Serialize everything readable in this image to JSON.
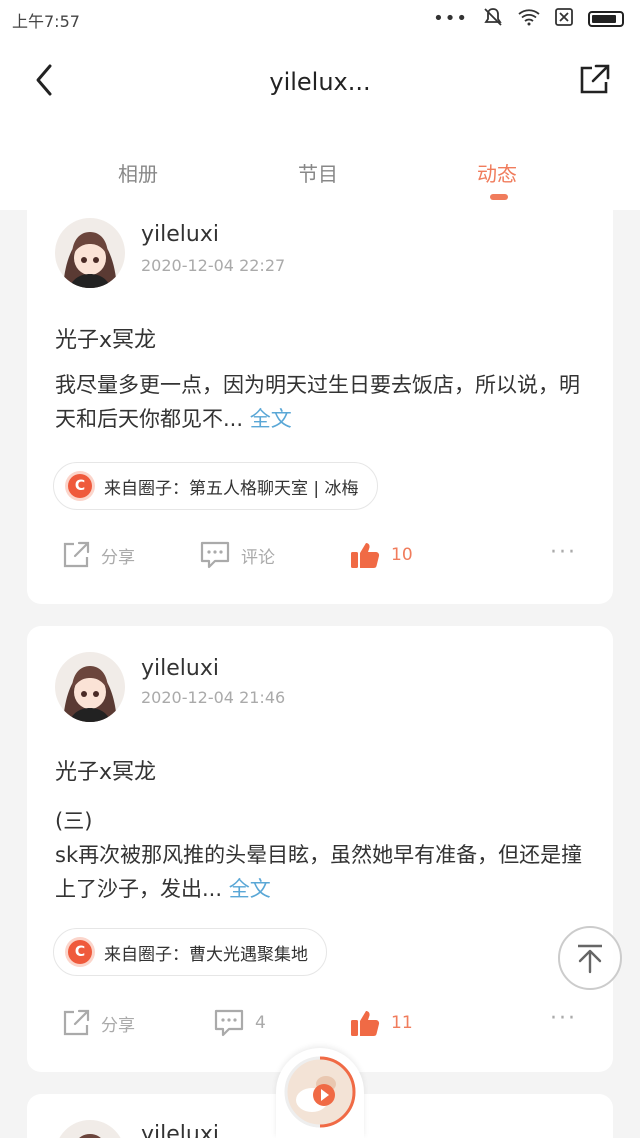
{
  "status_bar": {
    "time": "上午7:57",
    "dots": "•••"
  },
  "nav": {
    "title": "yilelux..."
  },
  "tabs": [
    {
      "label": "相册"
    },
    {
      "label": "节目"
    },
    {
      "label": "动态",
      "active": true
    }
  ],
  "posts": [
    {
      "username": "yileluxi",
      "timestamp": "2020-12-04 22:27",
      "title": "光子x冥龙",
      "body": "我尽量多更一点，因为明天过生日要去饭店，所以说，明天和后天你都见不...",
      "fulltext": "全文",
      "circle": "来自圈子：第五人格聊天室 | 冰梅",
      "share_label": "分享",
      "comment_label": "评论",
      "like_count": "10"
    },
    {
      "username": "yileluxi",
      "timestamp": "2020-12-04 21:46",
      "title": "光子x冥龙",
      "body_line1": "(三)",
      "body": "sk再次被那风推的头晕目眩，虽然她早有准备，但还是撞上了沙子，发出...",
      "fulltext": "全文",
      "circle": "来自圈子：曹大光遇聚集地",
      "share_label": "分享",
      "comment_count": "4",
      "like_count": "11"
    },
    {
      "username": "yileluxi"
    }
  ],
  "chip_icon_letter": "C",
  "more_label": "···",
  "colors": {
    "accent": "#f07c5c",
    "link": "#5aa7d6",
    "muted": "#aaaaaa"
  }
}
